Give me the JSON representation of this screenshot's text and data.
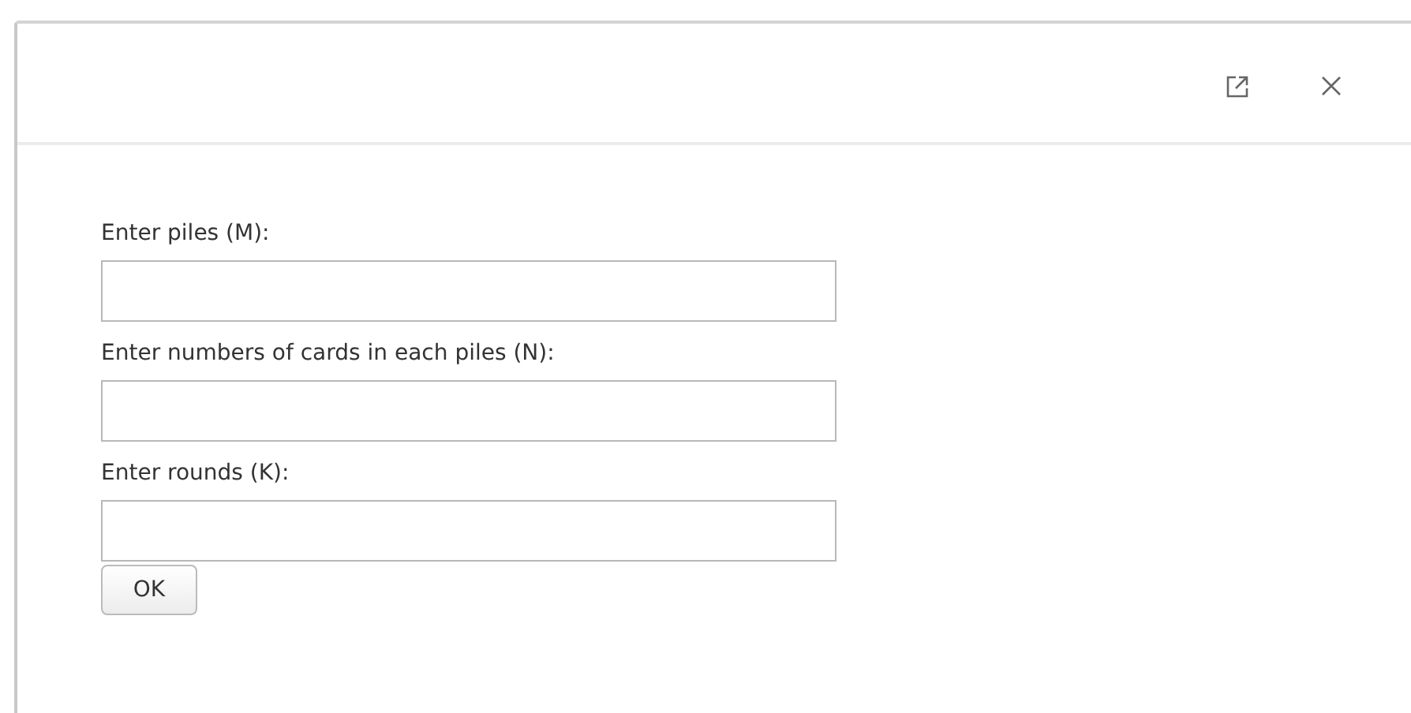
{
  "fields": [
    {
      "label": "Enter piles (M):"
    },
    {
      "label": "Enter numbers of cards in each piles (N):"
    },
    {
      "label": "Enter rounds (K):"
    }
  ],
  "buttons": [
    "OK"
  ]
}
